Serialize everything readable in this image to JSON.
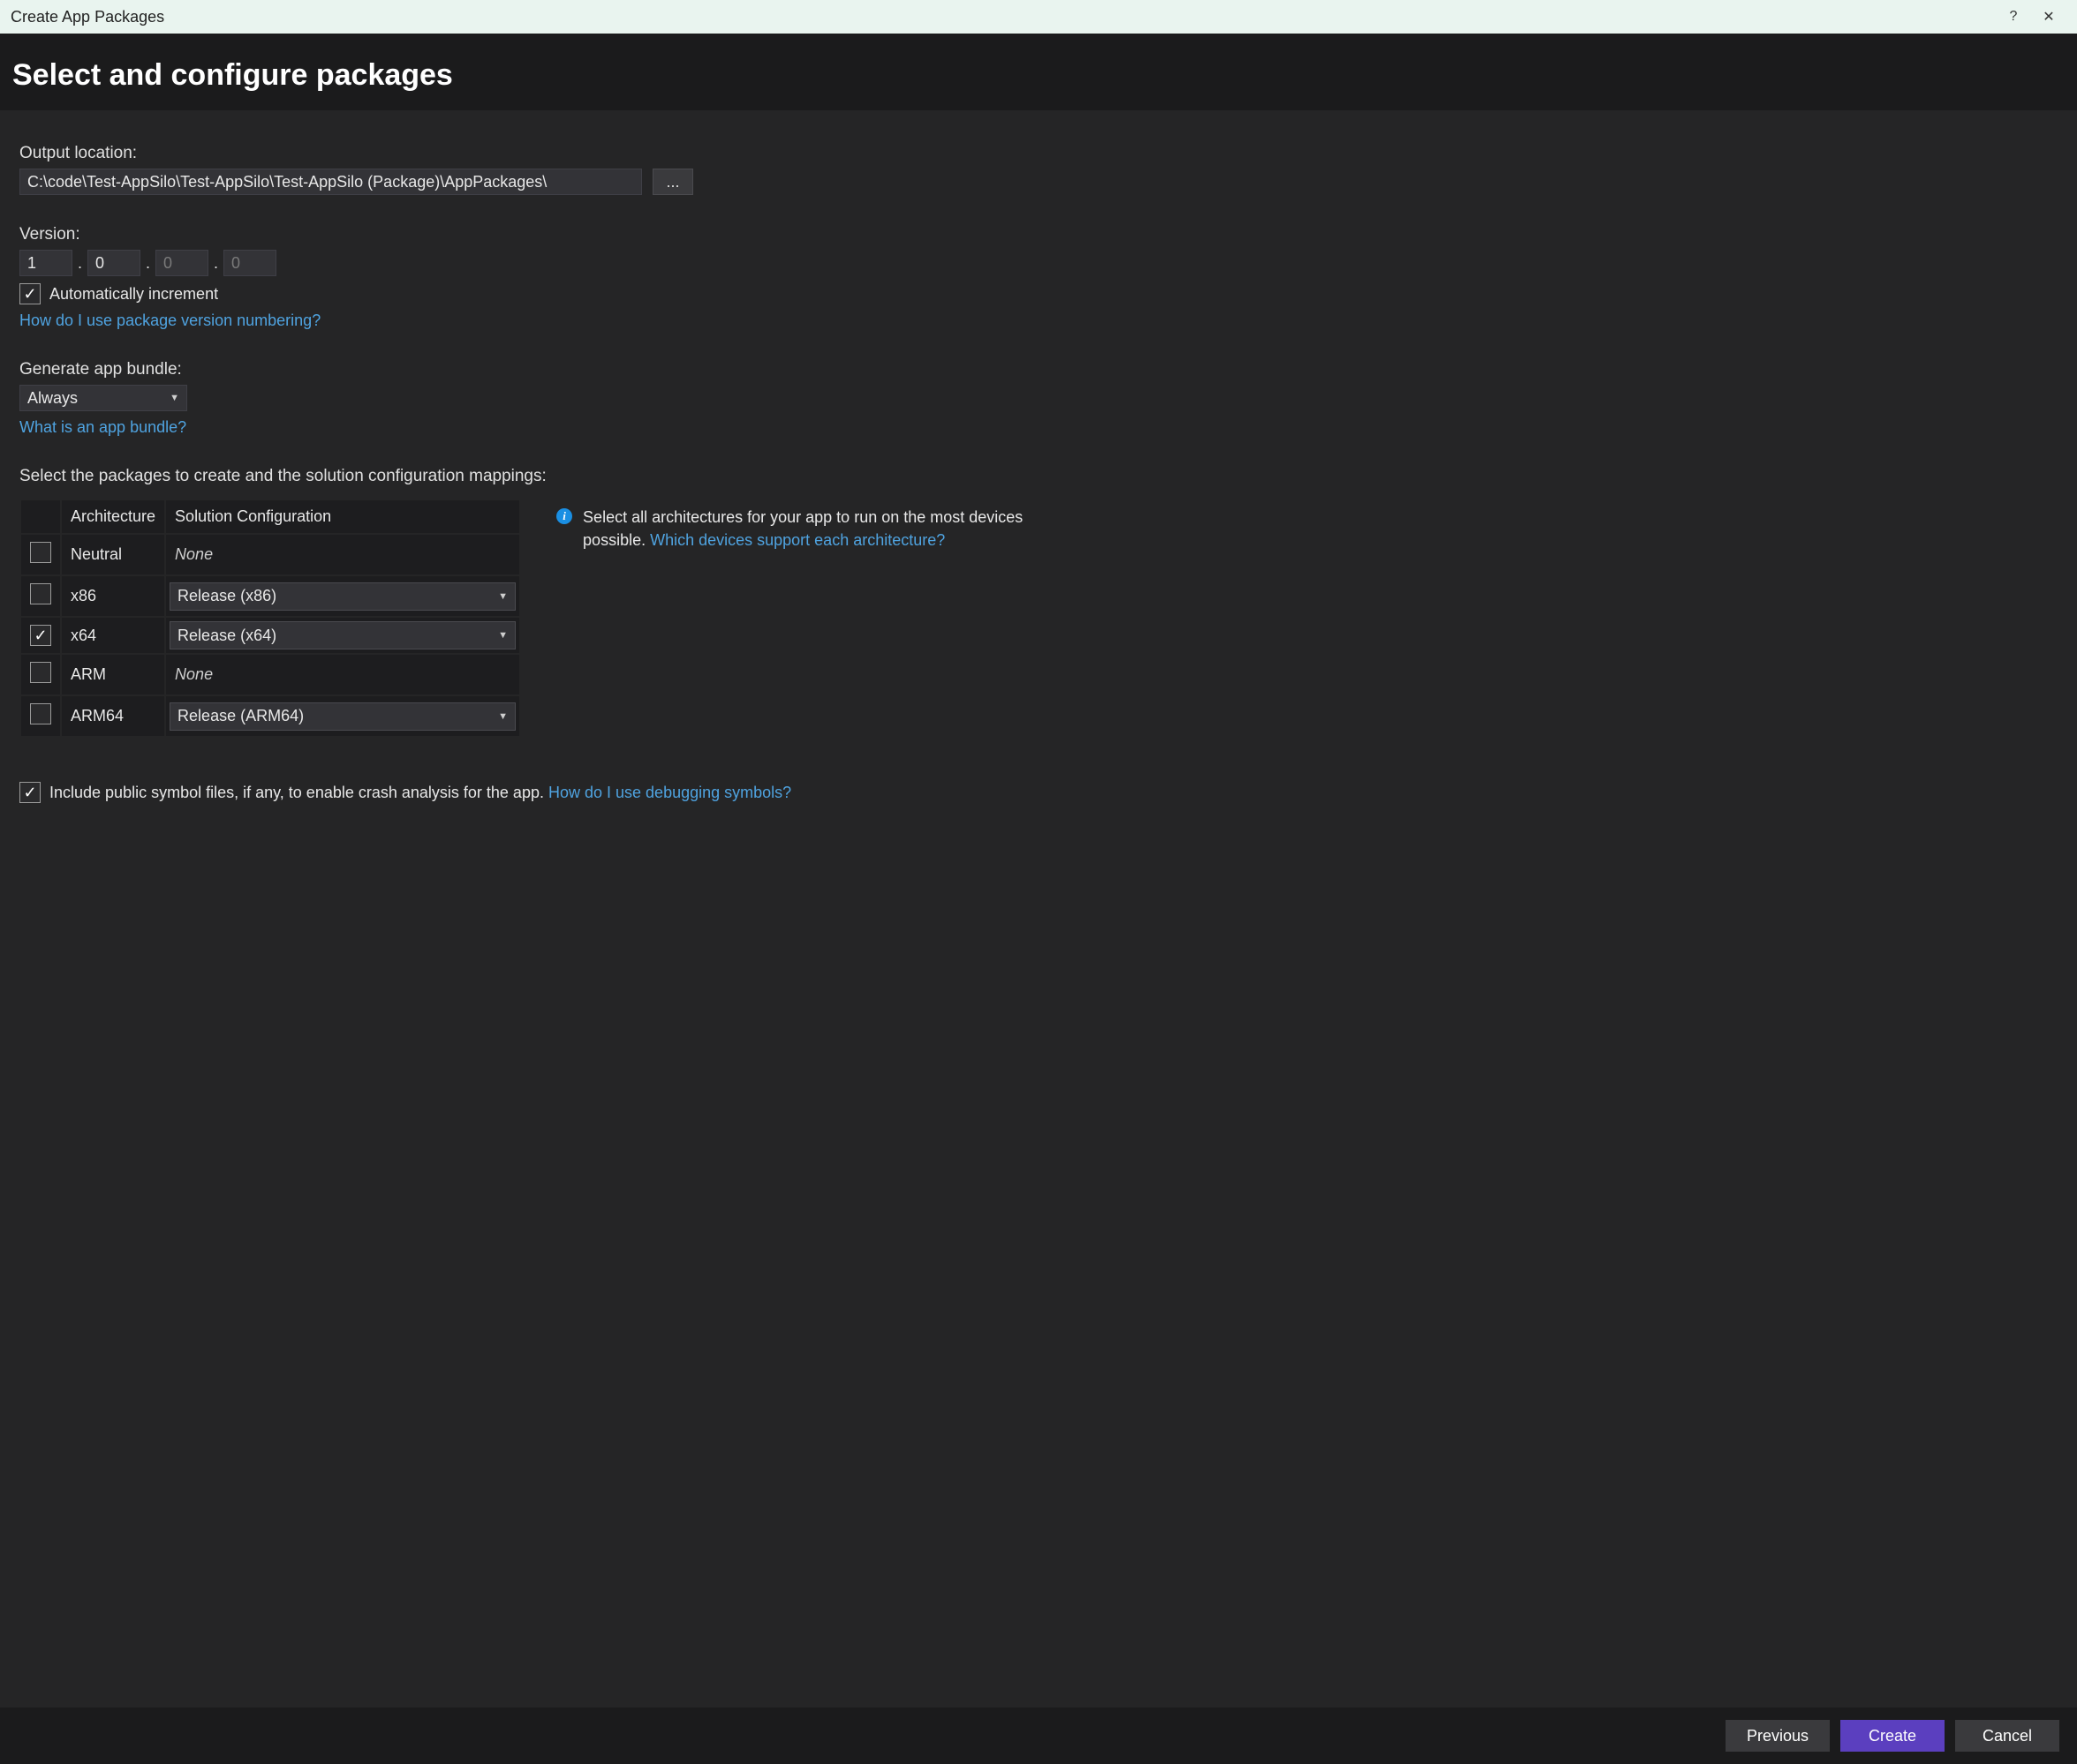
{
  "window": {
    "title": "Create App Packages",
    "help_glyph": "?",
    "close_glyph": "✕"
  },
  "header": {
    "title": "Select and configure packages"
  },
  "output": {
    "label": "Output location:",
    "value": "C:\\code\\Test-AppSilo\\Test-AppSilo\\Test-AppSilo (Package)\\AppPackages\\",
    "browse_glyph": "..."
  },
  "version": {
    "label": "Version:",
    "major": "1",
    "minor": "0",
    "build": "0",
    "revision": "0",
    "auto_increment_checked": true,
    "auto_increment_label": "Automatically increment",
    "help_link": "How do I use package version numbering?"
  },
  "bundle": {
    "label": "Generate app bundle:",
    "value": "Always",
    "help_link": "What is an app bundle?"
  },
  "packages": {
    "label": "Select the packages to create and the solution configuration mappings:",
    "headers": {
      "arch": "Architecture",
      "conf": "Solution Configuration"
    },
    "rows": [
      {
        "checked": false,
        "arch": "Neutral",
        "conf": "None",
        "has_select": false
      },
      {
        "checked": false,
        "arch": "x86",
        "conf": "Release (x86)",
        "has_select": true
      },
      {
        "checked": true,
        "arch": "x64",
        "conf": "Release (x64)",
        "has_select": true
      },
      {
        "checked": false,
        "arch": "ARM",
        "conf": "None",
        "has_select": false
      },
      {
        "checked": false,
        "arch": "ARM64",
        "conf": "Release (ARM64)",
        "has_select": true
      }
    ],
    "info": {
      "text_prefix": "Select all architectures for your app to run on the most devices possible. ",
      "link": "Which devices support each architecture?"
    }
  },
  "symbols": {
    "checked": true,
    "label": "Include public symbol files, if any, to enable crash analysis for the app. ",
    "link": "How do I use debugging symbols?"
  },
  "footer": {
    "previous": "Previous",
    "create": "Create",
    "cancel": "Cancel"
  }
}
